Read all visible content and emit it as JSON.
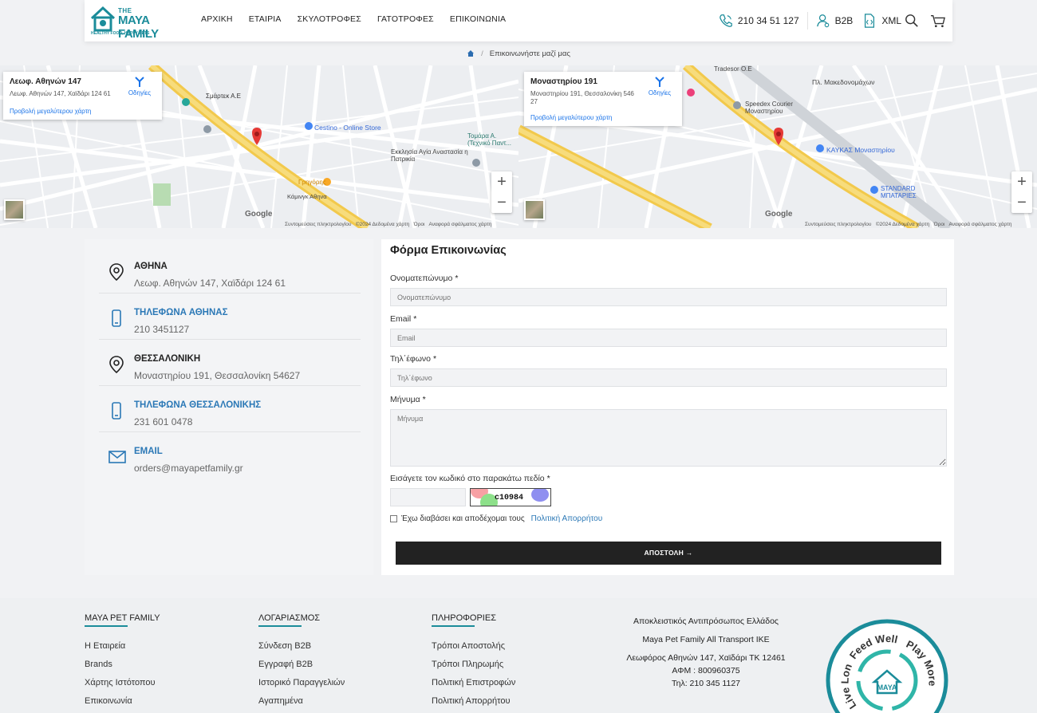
{
  "header": {
    "logo": {
      "line1": "THE",
      "line2": "MAYA FAMILY",
      "tagline": "HEALTHY FOOD, HAPPY PETS"
    },
    "nav": [
      "ΑΡΧΙΚΗ",
      "ΕΤΑΙΡΙΑ",
      "ΣΚΥΛΟΤΡΟΦΕΣ",
      "ΓΑΤΟΤΡΟΦΕΣ",
      "ΕΠΙΚΟΙΝΩΝΙΑ"
    ],
    "phone": "210 34 51 127",
    "b2b": "B2B",
    "xml": "XML"
  },
  "breadcrumb": {
    "current": "Επικοινωνήστε μαζί μας"
  },
  "maps": [
    {
      "title": "Λεωφ. Αθηνών 147",
      "address": "Λεωφ. Αθηνών 147, Χαϊδάρι 124 61",
      "directions": "Οδηγίες",
      "larger_map": "Προβολή μεγαλύτερου χάρτη",
      "labels": [
        "Σμάρτεκ Α.Ε",
        "Cestino - Online Store",
        "Τομάρα Α. (Τεχνικό Παντ...",
        "Εκκλησία Αγία Αναστασία η Πατρικία",
        "Γρηγόρης",
        "Κάμινγκ Αθηνα"
      ],
      "footer": [
        "Συντομεύσεις πληκτρολογίου",
        "©2024 Δεδομένα χάρτη",
        "Όροι",
        "Αναφορά σφάλματος χάρτη"
      ]
    },
    {
      "title": "Μοναστηρίου 191",
      "address": "Μοναστηρίου 191, Θεσσαλονίκη 546 27",
      "directions": "Οδηγίες",
      "larger_map": "Προβολή μεγαλύτερου χάρτη",
      "labels": [
        "Tradesor Ο.Ε",
        "Speedex Courier Μοναστηρίου",
        "ΚΑΥΚΑΣ Μοναστηρίου",
        "STANDARD ΜΠΑΤΑΡΙΕΣ",
        "Πλ. Μακεδονομάχων"
      ],
      "footer": [
        "Συντομεύσεις πληκτρολογίου",
        "©2024 Δεδομένα χάρτη",
        "Όροι",
        "Αναφορά σφάλματος χάρτη"
      ]
    }
  ],
  "google": "Google",
  "contact": [
    {
      "title": "ΑΘΗΝΑ",
      "value": "Λεωφ. Αθηνών 147, Χαϊδάρι 124 61",
      "icon": "location-pin-icon",
      "blue": false
    },
    {
      "title": "ΤΗΛΕΦΩΝΑ ΑΘΗΝΑΣ",
      "value": "210 3451127",
      "icon": "mobile-phone-icon",
      "blue": true
    },
    {
      "title": "ΘΕΣΣΑΛΟΝΙΚΗ",
      "value": "Μοναστηρίου 191, Θεσσαλονίκη 54627",
      "icon": "location-pin-icon",
      "blue": false
    },
    {
      "title": "ΤΗΛΕΦΩΝΑ ΘΕΣΣΑΛΟΝΙΚΗΣ",
      "value": "231 601 0478",
      "icon": "mobile-phone-icon",
      "blue": true
    },
    {
      "title": "EMAIL",
      "value": "orders@mayapetfamily.gr",
      "icon": "envelope-icon",
      "blue": true
    }
  ],
  "form": {
    "title": "Φόρμα Επικοινωνίας",
    "name_label": "Ονοματεπώνυμο",
    "name_placeholder": "Ονοματεπώνυμο",
    "email_label": "Email",
    "email_placeholder": "Email",
    "phone_label": "Τηλ΄έφωνο",
    "phone_placeholder": "Τηλ΄έφωνο",
    "message_label": "Μήνυμα",
    "message_placeholder": "Μήνυμα",
    "captcha_label": "Εισάγετε τον κωδικό στο παρακάτω πεδίο",
    "captcha_code": "c10984",
    "required_mark": "*",
    "privacy_text": "Έχω διαβάσει και αποδέχομαι τους",
    "privacy_link": "Πολιτική Απορρήτου",
    "submit": "ΑΠΟΣΤΟΛΗ →"
  },
  "footer": {
    "col1": {
      "title": "MAYA PET FAMILY",
      "links": [
        "Η Εταιρεία",
        "Brands",
        "Χάρτης Ιστότοπου",
        "Επικοινωνία"
      ]
    },
    "col2": {
      "title": "ΛΟΓΑΡΙΑΣΜΟΣ",
      "links": [
        "Σύνδεση B2B",
        "Εγγραφή B2B",
        "Ιστορικό Παραγγελιών",
        "Αγαπημένα"
      ]
    },
    "col3": {
      "title": "ΠΛΗΡΟΦΟΡΙΕΣ",
      "links": [
        "Τρόποι Αποστολής",
        "Τρόποι Πληρωμής",
        "Πολιτική Επιστροφών",
        "Πολιτική Απορρήτου"
      ]
    },
    "rep_title": "Αποκλειστικός Αντιπρόσωπος Ελλάδος",
    "company": "Maya Pet Family All Transport IKE",
    "address": "Λεωφόρος Αθηνών 147, Χαϊδάρι ΤΚ 12461",
    "afm": "ΑΦΜ : 800960375",
    "tel": "Τηλ: 210 345 1127",
    "badge_text": [
      "Feed Well",
      "Play More",
      "Live Long"
    ]
  },
  "colors": {
    "brand": "#1b8c9a",
    "link": "#2b78b6",
    "submit_bg": "#222222"
  }
}
